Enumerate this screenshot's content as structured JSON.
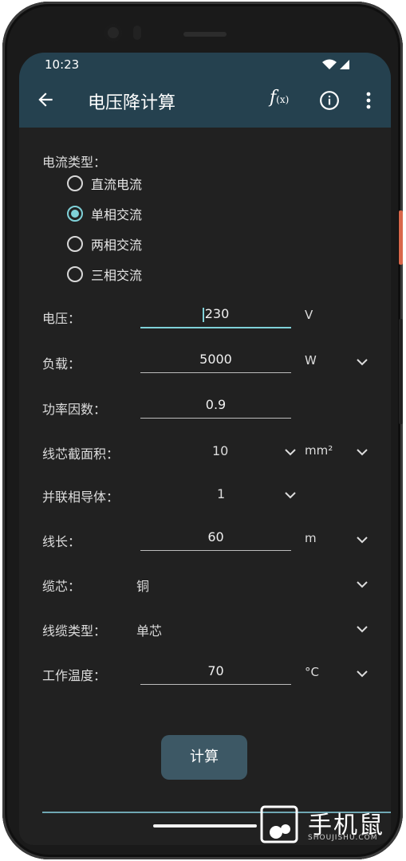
{
  "status": {
    "time": "10:23"
  },
  "appbar": {
    "title": "电压降计算",
    "fx_label": "f",
    "fx_sub": "(x)"
  },
  "current_type": {
    "label": "电流类型：",
    "options": [
      "直流电流",
      "单相交流",
      "两相交流",
      "三相交流"
    ],
    "selected": "单相交流"
  },
  "voltage": {
    "label": "电压：",
    "value": "230",
    "unit": "V"
  },
  "load": {
    "label": "负载：",
    "value": "5000",
    "unit": "W"
  },
  "power_factor": {
    "label": "功率因数：",
    "value": "0.9"
  },
  "cross_section": {
    "label": "线芯截面积：",
    "value": "10",
    "unit": "mm²"
  },
  "parallel": {
    "label": "并联相导体：",
    "value": "1"
  },
  "length": {
    "label": "线长：",
    "value": "60",
    "unit": "m"
  },
  "core": {
    "label": "缆芯：",
    "value": "铜"
  },
  "cable_type": {
    "label": "线缆类型：",
    "value": "单芯"
  },
  "temperature": {
    "label": "工作温度：",
    "value": "70",
    "unit": "°C"
  },
  "calculate_button": "计算",
  "watermark": {
    "text": "手机鼠",
    "sub": "SHOUJISHU.COM"
  },
  "colors": {
    "appbar": "#25414f",
    "background": "#212121",
    "accent": "#7fd1d8",
    "button": "#3d5865"
  }
}
